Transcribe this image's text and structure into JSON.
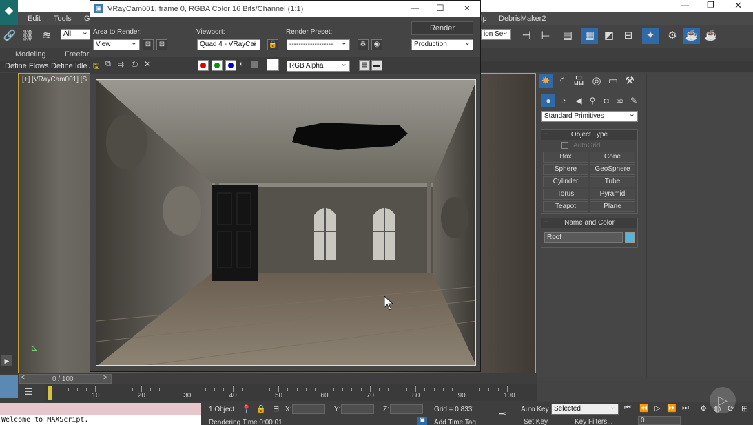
{
  "main_window": {
    "menu": [
      "Edit",
      "Tools",
      "G",
      "lp",
      "DebrisMaker2"
    ],
    "toolbar": {
      "selection_filter": "All",
      "right_dropdown": "ion Se"
    },
    "ribbon_tabs": [
      "Modeling",
      "Freeforn"
    ],
    "ribbon_sub": [
      "Define Flows",
      "Define Idle A"
    ],
    "viewport_label": "[+] [VRayCam001] [S",
    "window_controls": {
      "minimize": "—",
      "restore": "❐",
      "close": "✕"
    }
  },
  "render_window": {
    "title": "VRayCam001, frame 0, RGBA Color 16 Bits/Channel (1:1)",
    "area_to_render": {
      "label": "Area to Render:",
      "value": "View"
    },
    "viewport": {
      "label": "Viewport:",
      "value": "Quad 4 - VRayCai"
    },
    "render_preset": {
      "label": "Render Preset:",
      "value": "-------------------"
    },
    "render_button": "Render",
    "production": "Production",
    "channel": "RGB Alpha",
    "controls": {
      "minimize": "—",
      "maximize": "☐",
      "close": "✕"
    }
  },
  "command_panel": {
    "category": "Standard Primitives",
    "object_type_header": "Object Type",
    "autogrid": "AutoGrid",
    "primitives": [
      [
        "Box",
        "Cone"
      ],
      [
        "Sphere",
        "GeoSphere"
      ],
      [
        "Cylinder",
        "Tube"
      ],
      [
        "Torus",
        "Pyramid"
      ],
      [
        "Teapot",
        "Plane"
      ]
    ],
    "name_color_header": "Name and Color",
    "object_name": "Roof",
    "object_color": "#4fb8d8"
  },
  "timeline": {
    "frame_counter": "0 / 100",
    "ticks": [
      "10",
      "20",
      "30",
      "40",
      "50",
      "60",
      "70",
      "80",
      "90",
      "100"
    ]
  },
  "status": {
    "maxscript": "Welcome to MAXScript.",
    "selection": "1 Object",
    "x_label": "X:",
    "y_label": "Y:",
    "z_label": "Z:",
    "grid": "Grid = 0.833'",
    "rendering_time": "Rendering Time  0:00:01",
    "add_time_tag": "Add Time Tag",
    "auto_key": "Auto Key",
    "selected": "Selected",
    "set_key": "Set Key",
    "key_filters": "Key Filters...",
    "frame_field": "0"
  }
}
